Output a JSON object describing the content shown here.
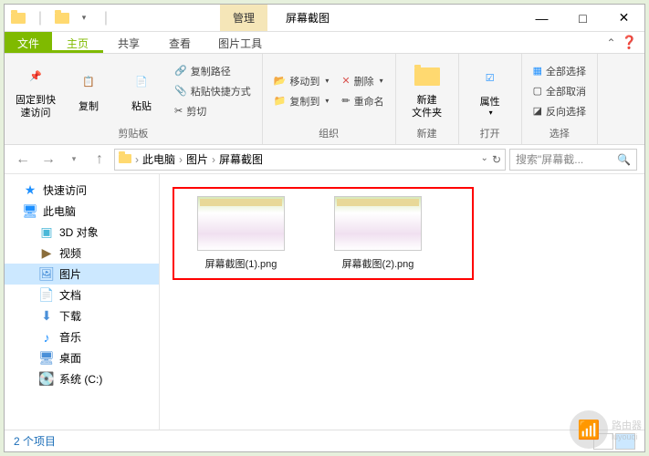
{
  "window": {
    "title_tab": "管理",
    "title": "屏幕截图",
    "buttons": {
      "min": "—",
      "max": "□",
      "close": "✕"
    }
  },
  "tabs": {
    "file": "文件",
    "home": "主页",
    "share": "共享",
    "view": "查看",
    "tool": "图片工具"
  },
  "ribbon": {
    "pin": "固定到快\n速访问",
    "copy": "复制",
    "paste": "粘贴",
    "copypath": "复制路径",
    "pasteshortcut": "粘贴快捷方式",
    "cut": "剪切",
    "clipboard": "剪贴板",
    "moveto": "移动到",
    "copyto": "复制到",
    "delete": "删除",
    "rename": "重命名",
    "organize": "组织",
    "newfolder": "新建\n文件夹",
    "new": "新建",
    "properties": "属性",
    "open": "打开",
    "selectall": "全部选择",
    "selectnone": "全部取消",
    "invertsel": "反向选择",
    "select": "选择"
  },
  "breadcrumb": {
    "pc": "此电脑",
    "pictures": "图片",
    "screenshots": "屏幕截图"
  },
  "search": {
    "placeholder": "搜索\"屏幕截..."
  },
  "sidebar": {
    "items": [
      {
        "label": "快速访问",
        "icon": "★",
        "color": "#1e90ff"
      },
      {
        "label": "此电脑",
        "icon": "🖥",
        "color": "#1e90ff"
      },
      {
        "label": "3D 对象",
        "icon": "▣",
        "color": "#4ab8d8",
        "child": true
      },
      {
        "label": "视频",
        "icon": "▶",
        "color": "#8a6d3b",
        "child": true
      },
      {
        "label": "图片",
        "icon": "🖼",
        "color": "#4a90d8",
        "child": true,
        "selected": true
      },
      {
        "label": "文档",
        "icon": "📄",
        "color": "#4a90d8",
        "child": true
      },
      {
        "label": "下载",
        "icon": "⬇",
        "color": "#4a90d8",
        "child": true
      },
      {
        "label": "音乐",
        "icon": "♪",
        "color": "#1e90ff",
        "child": true
      },
      {
        "label": "桌面",
        "icon": "🖥",
        "color": "#4a90d8",
        "child": true
      },
      {
        "label": "系统 (C:)",
        "icon": "💽",
        "color": "#888",
        "child": true
      }
    ]
  },
  "files": [
    {
      "name": "屏幕截图(1).png"
    },
    {
      "name": "屏幕截图(2).png"
    }
  ],
  "status": {
    "count": "2 个项目"
  },
  "watermark": {
    "text": "路由器",
    "sub": "luyouqi"
  }
}
